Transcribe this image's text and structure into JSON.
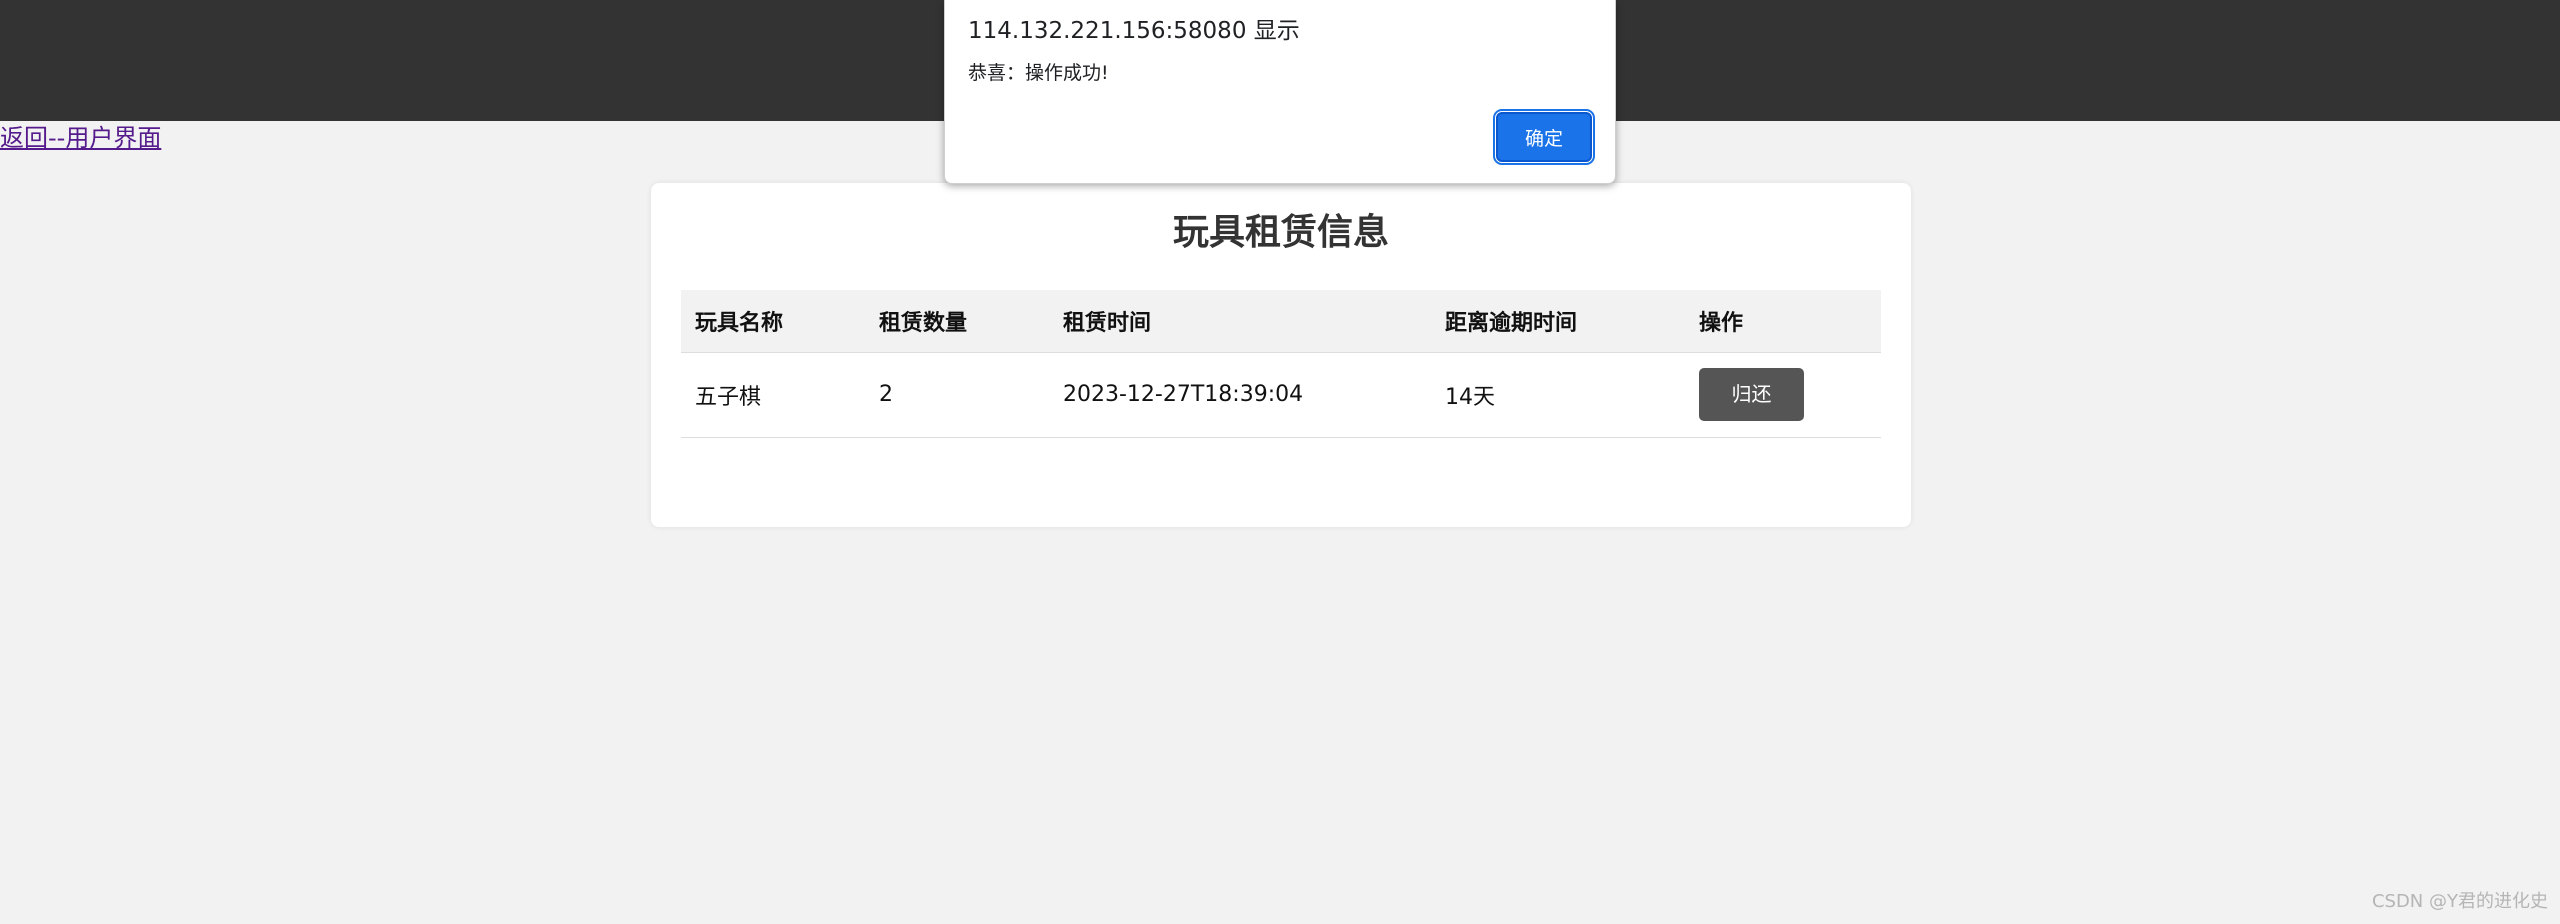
{
  "back_link": "返回--用户界面",
  "card": {
    "title": "玩具租赁信息",
    "columns": [
      "玩具名称",
      "租赁数量",
      "租赁时间",
      "距离逾期时间",
      "操作"
    ],
    "rows": [
      {
        "toy_name": "五子棋",
        "quantity": "2",
        "rent_time": "2023-12-27T18:39:04",
        "overdue_remaining": "14天",
        "action_label": "归还"
      }
    ]
  },
  "dialog": {
    "origin": "114.132.221.156:58080 显示",
    "message": "恭喜：操作成功!",
    "ok_label": "确定"
  },
  "watermark": "CSDN @Y君的进化史",
  "colors": {
    "topbar": "#333333",
    "background": "#f2f2f2",
    "button": "#555555",
    "dialog_ok": "#1a73e8",
    "link_visited": "#551a8b"
  }
}
